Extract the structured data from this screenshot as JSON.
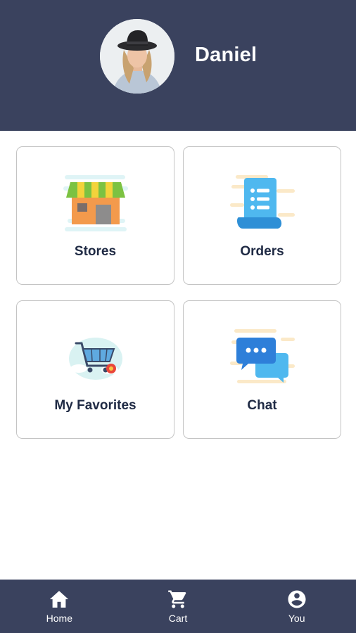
{
  "profile": {
    "name": "Daniel",
    "avatar_icon": "user-photo"
  },
  "menu": {
    "stores": {
      "label": "Stores",
      "icon": "storefront-icon"
    },
    "orders": {
      "label": "Orders",
      "icon": "receipt-list-icon"
    },
    "favorites": {
      "label": "My Favorites",
      "icon": "shopping-cart-heart-icon"
    },
    "chat": {
      "label": "Chat",
      "icon": "chat-bubbles-icon"
    }
  },
  "bottom_nav": {
    "home": {
      "label": "Home",
      "icon": "home-icon"
    },
    "cart": {
      "label": "Cart",
      "icon": "cart-icon"
    },
    "you": {
      "label": "You",
      "icon": "account-circle-icon"
    }
  },
  "colors": {
    "header_bg": "#3a425e",
    "nav_bg": "#3a425e",
    "label_text": "#1f2a44",
    "card_border": "#c4c4c4"
  }
}
